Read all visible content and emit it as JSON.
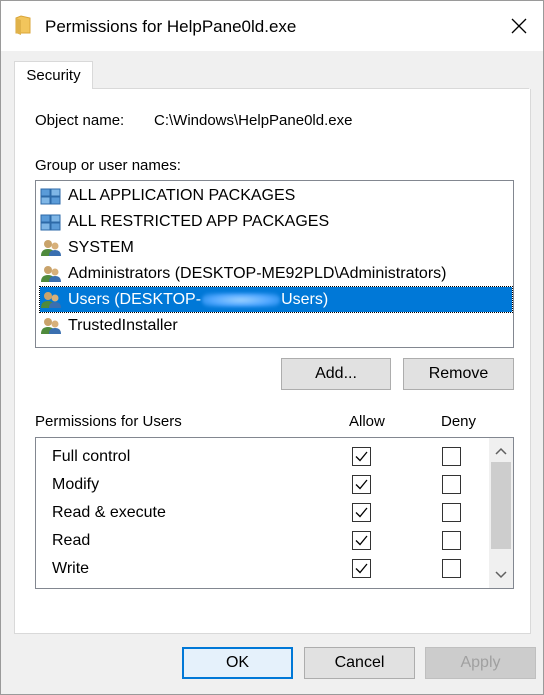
{
  "window": {
    "title": "Permissions for HelpPane0ld.exe"
  },
  "tabs": [
    {
      "label": "Security",
      "active": true
    }
  ],
  "object": {
    "label": "Object name:",
    "value": "C:\\Windows\\HelpPane0ld.exe"
  },
  "groups": {
    "label": "Group or user names:",
    "items": [
      {
        "label": "ALL APPLICATION PACKAGES",
        "icon": "package-group-icon"
      },
      {
        "label": "ALL RESTRICTED APP PACKAGES",
        "icon": "package-group-icon"
      },
      {
        "label": "SYSTEM",
        "icon": "users-icon"
      },
      {
        "label": "Administrators (DESKTOP-ME92PLD\\Administrators)",
        "icon": "users-icon"
      },
      {
        "label_prefix": "Users (DESKTOP-",
        "label_suffix": "Users)",
        "icon": "users-icon",
        "selected": true,
        "redacted": true
      },
      {
        "label": "TrustedInstaller",
        "icon": "users-icon"
      }
    ]
  },
  "group_buttons": {
    "add": "Add...",
    "remove": "Remove"
  },
  "permissions": {
    "title": "Permissions for Users",
    "allow_header": "Allow",
    "deny_header": "Deny",
    "rows": [
      {
        "name": "Full control",
        "allow": true,
        "deny": false
      },
      {
        "name": "Modify",
        "allow": true,
        "deny": false
      },
      {
        "name": "Read & execute",
        "allow": true,
        "deny": false
      },
      {
        "name": "Read",
        "allow": true,
        "deny": false
      },
      {
        "name": "Write",
        "allow": true,
        "deny": false
      }
    ]
  },
  "dialog_buttons": {
    "ok": "OK",
    "cancel": "Cancel",
    "apply": "Apply"
  },
  "colors": {
    "selection": "#0078d7",
    "folder": "#f2c55c"
  }
}
